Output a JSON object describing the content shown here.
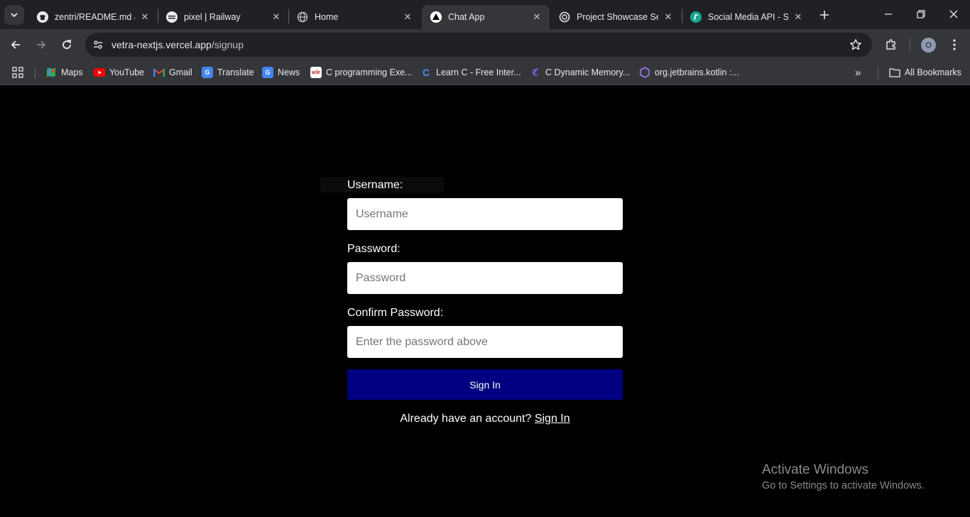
{
  "browser": {
    "tabs": [
      {
        "title": "zentri/README.md at",
        "icon": "github-icon"
      },
      {
        "title": "pixel | Railway",
        "icon": "railway-icon"
      },
      {
        "title": "Home",
        "icon": "globe-icon"
      },
      {
        "title": "Chat App",
        "icon": "nextjs-icon",
        "active": true
      },
      {
        "title": "Project Showcase Set",
        "icon": "openai-icon"
      },
      {
        "title": "Social Media API - Sw",
        "icon": "swagger-icon"
      }
    ],
    "url_host": "vetra-nextjs.vercel.app",
    "url_path": "/signup",
    "avatar_letter": "O",
    "bookmarks": [
      {
        "label": "Maps",
        "icon": "maps-icon"
      },
      {
        "label": "YouTube",
        "icon": "youtube-icon"
      },
      {
        "label": "Gmail",
        "icon": "gmail-icon"
      },
      {
        "label": "Translate",
        "icon": "translate-icon"
      },
      {
        "label": "News",
        "icon": "news-icon"
      },
      {
        "label": "C programming Exe...",
        "icon": "w3r-icon"
      },
      {
        "label": "Learn C - Free Inter...",
        "icon": "learnc-icon"
      },
      {
        "label": "C Dynamic Memory...",
        "icon": "c-icon"
      },
      {
        "label": "org.jetbrains.kotlin :...",
        "icon": "hex-icon"
      }
    ],
    "all_bookmarks": "All Bookmarks"
  },
  "form": {
    "username_label": "Username:",
    "username_placeholder": "Username",
    "password_label": "Password:",
    "password_placeholder": "Password",
    "confirm_label": "Confirm Password:",
    "confirm_placeholder": "Enter the password above",
    "submit_label": "Sign In",
    "account_prompt": "Already have an account?",
    "account_link": "Sign In"
  },
  "watermark": {
    "line1": "Activate Windows",
    "line2": "Go to Settings to activate Windows."
  },
  "colors": {
    "button": "#000080",
    "page_bg": "#000000",
    "chrome_bg": "#202124",
    "toolbar_bg": "#35363a"
  }
}
